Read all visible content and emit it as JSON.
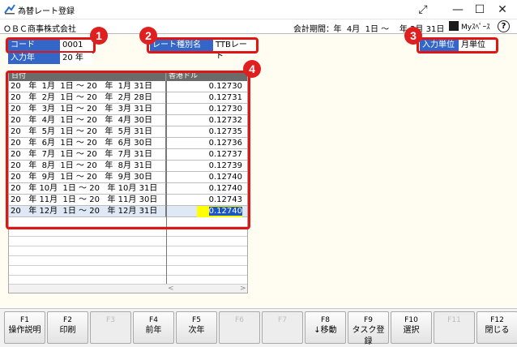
{
  "window": {
    "title": "為替レート登録",
    "maximize_alt": "⤢",
    "minimize": "—",
    "restore": "☐",
    "close": "✕"
  },
  "infobar": {
    "company": "ＯＢＣ商事株式会社",
    "fiscal_label": "会計期間：",
    "fiscal_value": "   年  4月  1日 ～    年 3月 31日",
    "myspace": "Myｽﾍﾟｰｽ",
    "help": "?"
  },
  "fields": {
    "code_label": "コード",
    "code_value": "0001",
    "year_label": "入力年",
    "year_value": "20   年",
    "rate_type_label": "レート種別名",
    "rate_type_value": "TTBレート",
    "unit_label": "入力単位",
    "unit_value": "月単位"
  },
  "callouts": [
    "1",
    "2",
    "3",
    "4"
  ],
  "grid": {
    "col_date": "日付",
    "col_rate": "香港ドル",
    "rows": [
      {
        "period": "20   年  1月  1日 ～ 20   年  1月 31日",
        "rate": "0.12730"
      },
      {
        "period": "20   年  2月  1日 ～ 20   年  2月 28日",
        "rate": "0.12731"
      },
      {
        "period": "20   年  3月  1日 ～ 20   年  3月 31日",
        "rate": "0.12730"
      },
      {
        "period": "20   年  4月  1日 ～ 20   年  4月 30日",
        "rate": "0.12732"
      },
      {
        "period": "20   年  5月  1日 ～ 20   年  5月 31日",
        "rate": "0.12735"
      },
      {
        "period": "20   年  6月  1日 ～ 20   年  6月 30日",
        "rate": "0.12736"
      },
      {
        "period": "20   年  7月  1日 ～ 20   年  7月 31日",
        "rate": "0.12737"
      },
      {
        "period": "20   年  8月  1日 ～ 20   年  8月 31日",
        "rate": "0.12739"
      },
      {
        "period": "20   年  9月  1日 ～ 20   年  9月 30日",
        "rate": "0.12740"
      },
      {
        "period": "20   年 10月  1日 ～ 20   年 10月 31日",
        "rate": "0.12740"
      },
      {
        "period": "20   年 11月  1日 ～ 20   年 11月 30日",
        "rate": "0.12743"
      },
      {
        "period": "20   年 12月  1日 ～ 20   年 12月 31日",
        "rate": "0.12740"
      }
    ],
    "scroll_left": "<",
    "scroll_right": ">"
  },
  "fkeys": [
    {
      "key": "F1",
      "label": "操作説明",
      "enabled": true
    },
    {
      "key": "F2",
      "label": "印刷",
      "enabled": true
    },
    {
      "key": "F3",
      "label": "",
      "enabled": false
    },
    {
      "key": "F4",
      "label": "前年",
      "enabled": true
    },
    {
      "key": "F5",
      "label": "次年",
      "enabled": true
    },
    {
      "key": "F6",
      "label": "",
      "enabled": false
    },
    {
      "key": "F7",
      "label": "",
      "enabled": false
    },
    {
      "key": "F8",
      "label": "↓移動",
      "enabled": true
    },
    {
      "key": "F9",
      "label": "タスク登録",
      "enabled": true
    },
    {
      "key": "F10",
      "label": "選択",
      "enabled": true
    },
    {
      "key": "F11",
      "label": "",
      "enabled": false
    },
    {
      "key": "F12",
      "label": "閉じる",
      "enabled": true
    }
  ],
  "colors": {
    "label_blue": "#3466c7",
    "callout_red": "#e01515",
    "highlight_yellow": "#ffff00",
    "panel_cream": "#fffdf1"
  }
}
